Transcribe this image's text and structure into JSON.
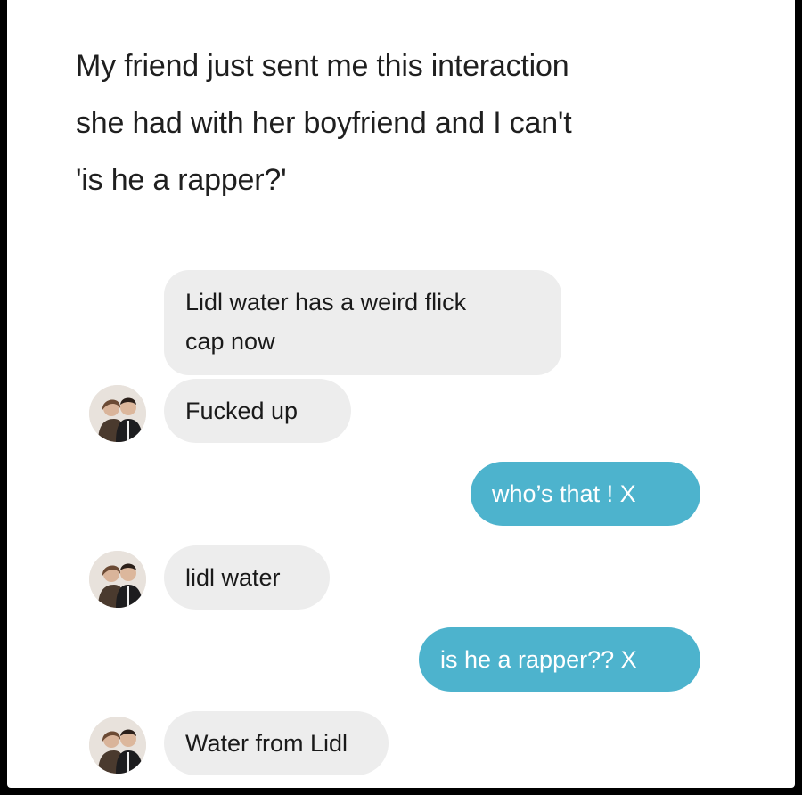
{
  "caption": {
    "line1": "My friend just sent me this interaction",
    "line2": "she had with her boyfriend and I can't",
    "line3": "'is he a rapper?'"
  },
  "messages": [
    {
      "sender": "boyfriend",
      "line1": "Lidl water has a weird flick",
      "line2": "cap now"
    },
    {
      "sender": "boyfriend",
      "text": "Fucked up"
    },
    {
      "sender": "me",
      "text": "who’s that ! X"
    },
    {
      "sender": "boyfriend",
      "text": "lidl water"
    },
    {
      "sender": "me",
      "text": "is he a rapper?? X"
    },
    {
      "sender": "boyfriend",
      "text": "Water from Lidl"
    }
  ],
  "colors": {
    "incoming_bubble": "#ededed",
    "outgoing_bubble": "#4db3cd",
    "background": "#ffffff",
    "frame": "#000000"
  },
  "icons": {
    "avatar": "couple-photo-avatar"
  }
}
